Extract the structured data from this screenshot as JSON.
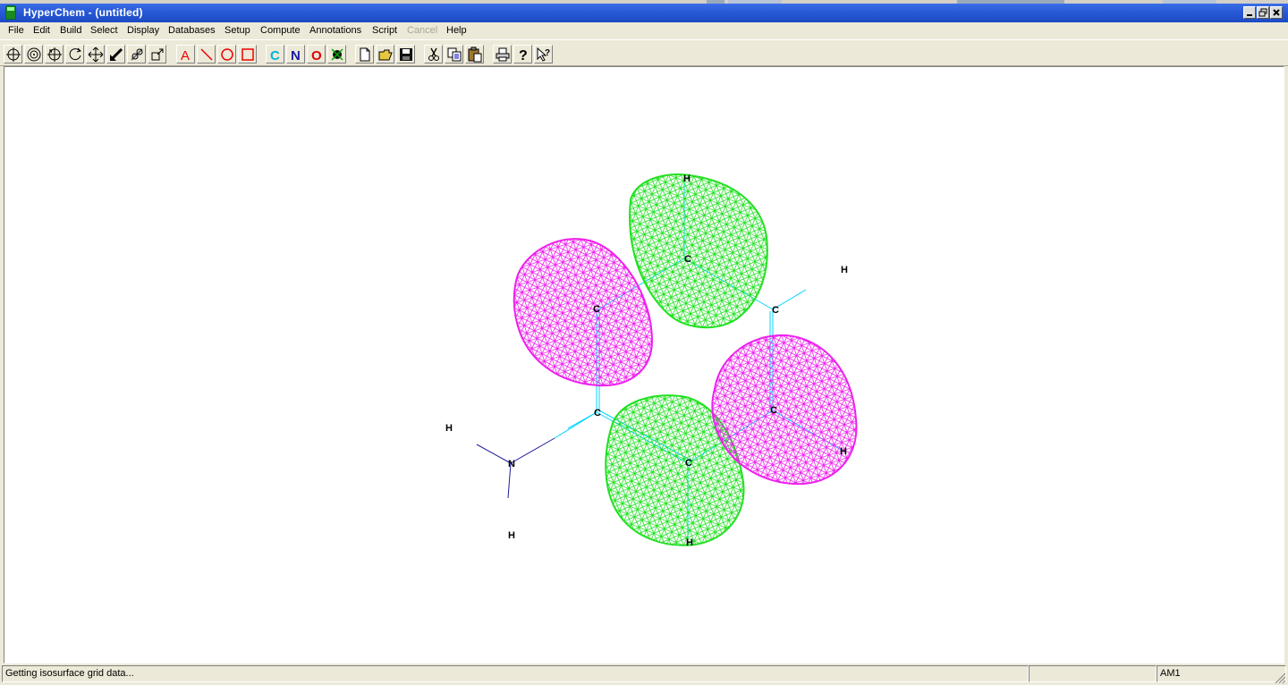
{
  "window": {
    "title": "HyperChem - (untitled)"
  },
  "menu": [
    {
      "label": "File",
      "enabled": true
    },
    {
      "label": "Edit",
      "enabled": true
    },
    {
      "label": "Build",
      "enabled": true
    },
    {
      "label": "Select",
      "enabled": true
    },
    {
      "label": "Display",
      "enabled": true
    },
    {
      "label": "Databases",
      "enabled": true
    },
    {
      "label": "Setup",
      "enabled": true
    },
    {
      "label": "Compute",
      "enabled": true
    },
    {
      "label": "Annotations",
      "enabled": true
    },
    {
      "label": "Script",
      "enabled": true
    },
    {
      "label": "Cancel",
      "enabled": false
    },
    {
      "label": "Help",
      "enabled": true
    }
  ],
  "toolbar": {
    "tools": [
      "draw-tool",
      "select-tool",
      "rotate-xy-tool",
      "rotate-z-tool",
      "translate-xy-tool",
      "translate-z-tool",
      "zoom-tool",
      "clip-tool"
    ],
    "annotations": [
      "A",
      "\\",
      "O",
      "□"
    ],
    "elements": [
      {
        "label": "C",
        "color": "#00b4d8"
      },
      {
        "label": "N",
        "color": "#1a1aa0"
      },
      {
        "label": "O",
        "color": "#e00000"
      }
    ],
    "files": [
      "new-file",
      "open-file",
      "save-file"
    ],
    "clipboard": [
      "cut",
      "copy",
      "paste"
    ],
    "misc": [
      "print",
      "help",
      "context-help"
    ]
  },
  "molecule": {
    "atoms": [
      {
        "symbol": "C",
        "label": "C"
      },
      {
        "symbol": "C",
        "label": "C"
      },
      {
        "symbol": "C",
        "label": "C"
      },
      {
        "symbol": "C",
        "label": "C"
      },
      {
        "symbol": "C",
        "label": "C"
      },
      {
        "symbol": "C",
        "label": "C"
      },
      {
        "symbol": "N",
        "label": "N"
      },
      {
        "symbol": "H",
        "label": "H"
      },
      {
        "symbol": "H",
        "label": "H"
      },
      {
        "symbol": "H",
        "label": "H"
      },
      {
        "symbol": "H",
        "label": "H"
      },
      {
        "symbol": "H",
        "label": "H"
      },
      {
        "symbol": "H",
        "label": "H"
      },
      {
        "symbol": "H",
        "label": "H"
      }
    ],
    "colors": {
      "bond_carbon": "#00d4ff",
      "bond_nitrogen": "#1c1c9c",
      "isosurface_positive": "#22e022",
      "isosurface_negative": "#ee20ee"
    }
  },
  "status": {
    "message": "Getting isosurface grid data...",
    "method": "AM1"
  }
}
